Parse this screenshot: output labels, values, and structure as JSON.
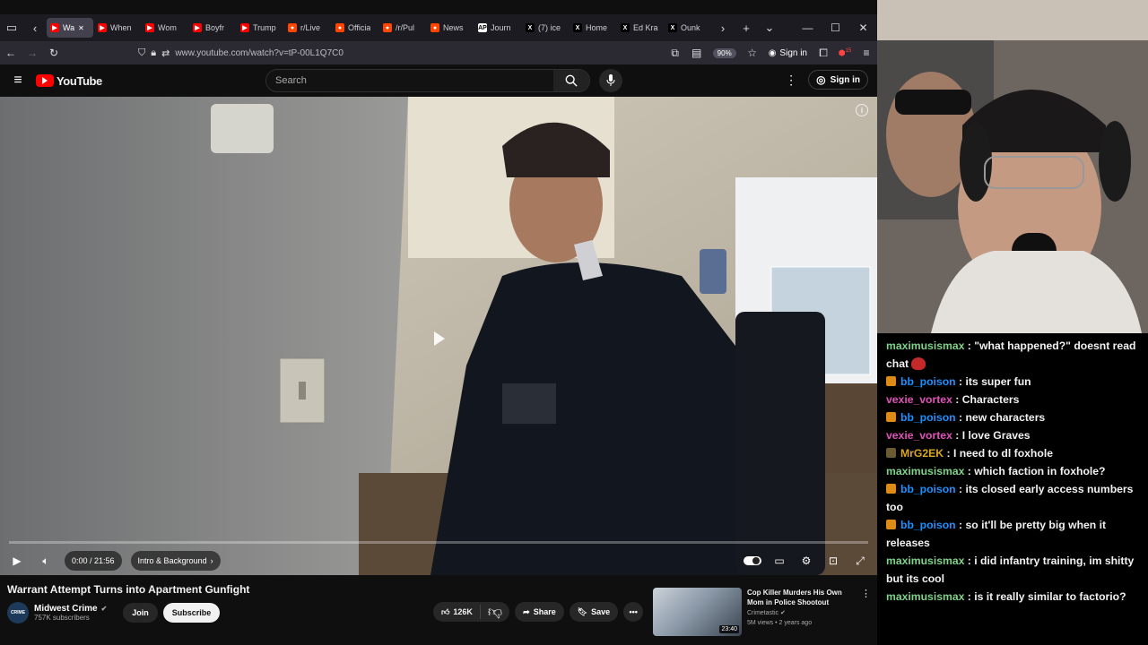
{
  "browser": {
    "tabs": [
      {
        "label": "Wa",
        "color": "#ff0000",
        "glyph": "▶",
        "active": true
      },
      {
        "label": "When",
        "color": "#ff0000",
        "glyph": "▶"
      },
      {
        "label": "Wom",
        "color": "#ff0000",
        "glyph": "▶"
      },
      {
        "label": "Boyfr",
        "color": "#ff0000",
        "glyph": "▶"
      },
      {
        "label": "Trump",
        "color": "#ff0000",
        "glyph": "▶"
      },
      {
        "label": "r/Live",
        "color": "#ff4500",
        "glyph": "●"
      },
      {
        "label": "Officia",
        "color": "#ff4500",
        "glyph": "●"
      },
      {
        "label": "/r/Pul",
        "color": "#ff4500",
        "glyph": "●"
      },
      {
        "label": "News",
        "color": "#ff4500",
        "glyph": "●"
      },
      {
        "label": "Journ",
        "color": "#fff",
        "glyph": "AP"
      },
      {
        "label": "(7) ice",
        "color": "#000",
        "glyph": "X"
      },
      {
        "label": "Home",
        "color": "#000",
        "glyph": "X"
      },
      {
        "label": "Ed Kra",
        "color": "#000",
        "glyph": "X"
      },
      {
        "label": "Ounk",
        "color": "#000",
        "glyph": "X"
      }
    ],
    "url": "www.youtube.com/watch?v=tP-00L1Q7C0",
    "zoom": "90%",
    "sign_in": "Sign in",
    "extension_badge": "15"
  },
  "youtube": {
    "logo_text": "YouTube",
    "search_placeholder": "Search",
    "sign_in": "Sign in"
  },
  "player": {
    "time": "0:00 / 21:56",
    "chapter": "Intro & Background",
    "progress_fraction": 0.0
  },
  "video": {
    "title": "Warrant Attempt Turns into Apartment Gunfight",
    "channel": "Midwest Crime",
    "channel_avatar_text": "CRIME",
    "subscribers": "757K subscribers",
    "join_label": "Join",
    "subscribe_label": "Subscribe",
    "likes": "126K",
    "share_label": "Share",
    "save_label": "Save"
  },
  "recommended": {
    "title": "Cop Killer Murders His Own Mom in Police Shootout",
    "channel": "Crimetastic",
    "meta": "5M views • 2 years ago",
    "duration": "23:40"
  },
  "chat": [
    {
      "user": "maximusismax",
      "color": "#7fd38b",
      "badge": false,
      "text": "\"what happened?\" doesnt read chat",
      "emote": true
    },
    {
      "user": "bb_poison",
      "color": "#1e90ff",
      "badge": true,
      "text": "its super fun"
    },
    {
      "user": "vexie_vortex",
      "color": "#e052b8",
      "badge": false,
      "text": "Characters"
    },
    {
      "user": "bb_poison",
      "color": "#1e90ff",
      "badge": true,
      "text": "new characters"
    },
    {
      "user": "vexie_vortex",
      "color": "#e052b8",
      "badge": false,
      "text": "I love Graves"
    },
    {
      "user": "MrG2EK",
      "color": "#daa520",
      "badge": true,
      "gold": true,
      "text": "I need to dl foxhole"
    },
    {
      "user": "maximusismax",
      "color": "#7fd38b",
      "badge": false,
      "text": "which faction in foxhole?"
    },
    {
      "user": "bb_poison",
      "color": "#1e90ff",
      "badge": true,
      "text": "its closed early access numbers too"
    },
    {
      "user": "bb_poison",
      "color": "#1e90ff",
      "badge": true,
      "text": "so it'll be pretty big when it releases"
    },
    {
      "user": "maximusismax",
      "color": "#7fd38b",
      "badge": false,
      "text": "i did infantry training, im shitty but its cool"
    },
    {
      "user": "maximusismax",
      "color": "#7fd38b",
      "badge": false,
      "text": "is it really similar to factorio?"
    }
  ]
}
